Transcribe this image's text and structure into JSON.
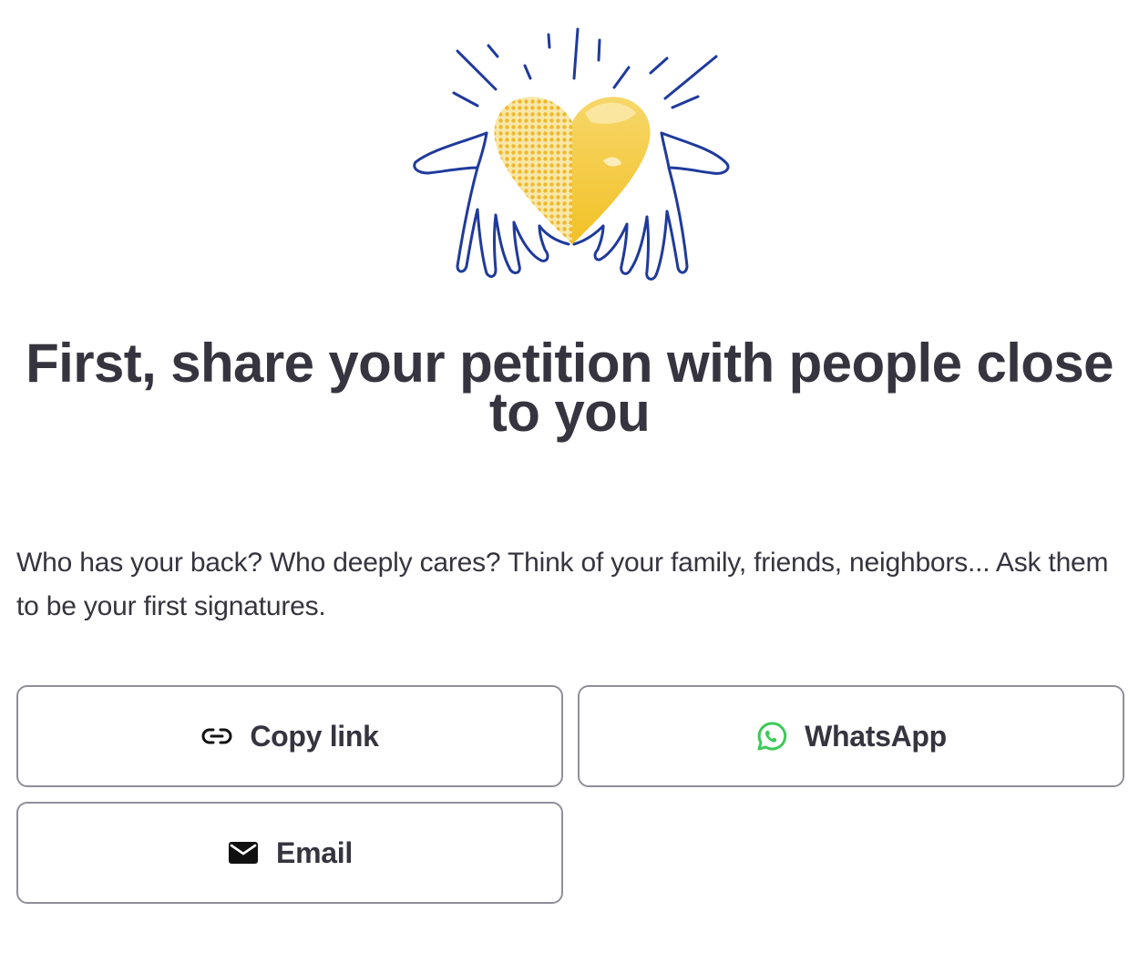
{
  "illustration": {
    "name": "hands-holding-heart-illustration",
    "colors": {
      "outline": "#1f3a9c",
      "heart_light": "#f6d87a",
      "heart_dark": "#f2c22a"
    }
  },
  "headline": "First, share your petition with people close to you",
  "intro": "Who has your back? Who deeply cares? Think of your family, friends, neighbors... Ask them to be your first signatures.",
  "share_buttons": {
    "copy_link": {
      "label": "Copy link",
      "icon": "link-icon"
    },
    "whatsapp": {
      "label": "WhatsApp",
      "icon": "whatsapp-icon",
      "icon_color": "#3ec95a"
    },
    "email": {
      "label": "Email",
      "icon": "mail-icon"
    }
  },
  "theme": {
    "text": "#36343f",
    "button_border": "#8f8f9b",
    "background": "#ffffff"
  }
}
